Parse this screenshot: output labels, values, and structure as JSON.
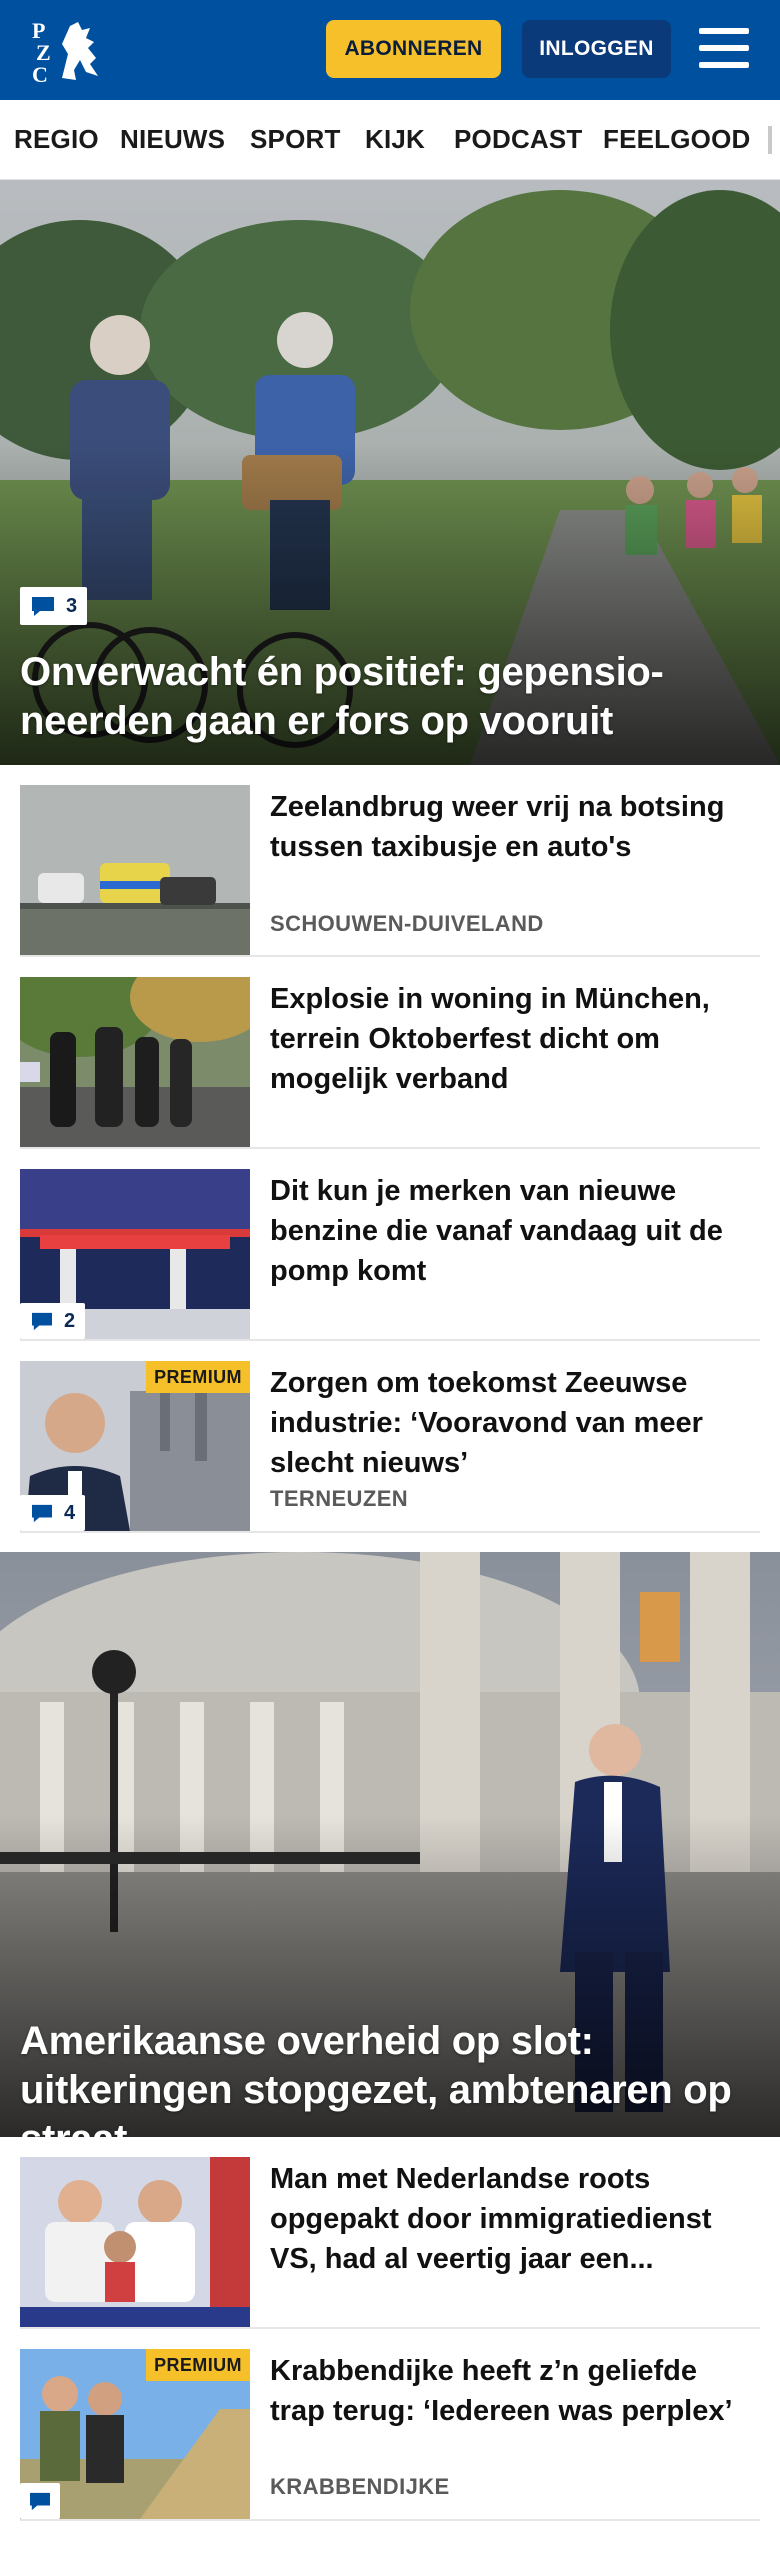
{
  "header": {
    "logo_letters": [
      "P",
      "Z",
      "C"
    ],
    "subscribe_label": "ABONNEREN",
    "login_label": "INLOGGEN",
    "colors": {
      "brand": "#0050a0",
      "accent": "#f5c02a",
      "login_bg": "#0a3a7a"
    }
  },
  "nav": {
    "items": [
      "REGIO",
      "NIEUWS",
      "SPORT",
      "KIJK",
      "PODCAST",
      "FEELGOOD"
    ]
  },
  "hero1": {
    "comments": "3",
    "title": "Onverwacht én positief: gepensio-neerden gaan er fors op vooruit"
  },
  "articles": [
    {
      "title": "Zeelandbrug weer vrij na botsing tussen taxibusje en auto's",
      "tag": "SCHOUWEN-DUIVELAND"
    },
    {
      "title": "Explosie in woning in München, terrein Oktoberfest dicht om mogelijk verband"
    },
    {
      "title": "Dit kun je merken van nieuwe benzine die vanaf vandaag uit de pomp komt",
      "comments": "2"
    },
    {
      "title": "Zorgen om toekomst Zeeuwse industrie: ‘Vooravond van meer slecht nieuws’",
      "tag": "TERNEUZEN",
      "premium": "PREMIUM",
      "comments": "4"
    }
  ],
  "hero2": {
    "title": "Amerikaanse overheid op slot: uitkeringen stopgezet, ambtenaren op straat"
  },
  "articles2": [
    {
      "title": "Man met Nederlandse roots opgepakt door immigratiedienst VS, had al veertig jaar een..."
    },
    {
      "title": "Krabbendijke heeft z’n geliefde trap terug: ‘Iedereen was perplex’",
      "tag": "KRABBENDIJKE",
      "premium": "PREMIUM"
    }
  ]
}
